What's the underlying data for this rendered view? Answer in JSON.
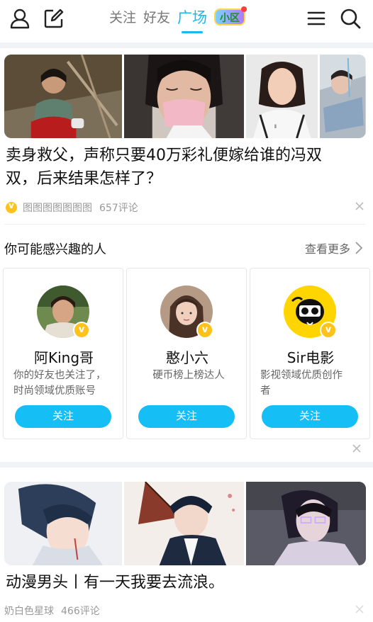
{
  "header": {
    "tabs": [
      {
        "label": "关注"
      },
      {
        "label": "好友"
      },
      {
        "label": "广场"
      }
    ],
    "badge_label": "小区",
    "icons": [
      "user-icon",
      "edit-icon",
      "menu-icon",
      "search-icon"
    ]
  },
  "post1": {
    "title_line1": "卖身救父，声称只要40万彩礼便嫁给谁的冯双",
    "title_line2": "双，后来结果怎样了？",
    "author": "图图图图图图图",
    "comments": "657评论"
  },
  "recommend": {
    "title": "你可能感兴趣的人",
    "more_label": "查看更多",
    "users": [
      {
        "name": "阿King哥",
        "desc_line1": "你的好友也关注了，",
        "desc_line2": "时尚领域优质账号",
        "follow_label": "关注",
        "badge": "v"
      },
      {
        "name": "憨小六",
        "desc_line1": "硬币榜上榜达人",
        "desc_line2": "",
        "follow_label": "关注",
        "badge": "v"
      },
      {
        "name": "Sir电影",
        "desc_line1": "影视领域优质创作",
        "desc_line2": "者",
        "follow_label": "关注",
        "badge": "v"
      }
    ]
  },
  "post2": {
    "title": "动漫男头丨有一天我要去流浪。",
    "author": "奶白色星球",
    "comments": "466评论"
  },
  "colors": {
    "accent": "#16b9f0",
    "button": "#15bef4",
    "vip": "#ffc21a"
  }
}
